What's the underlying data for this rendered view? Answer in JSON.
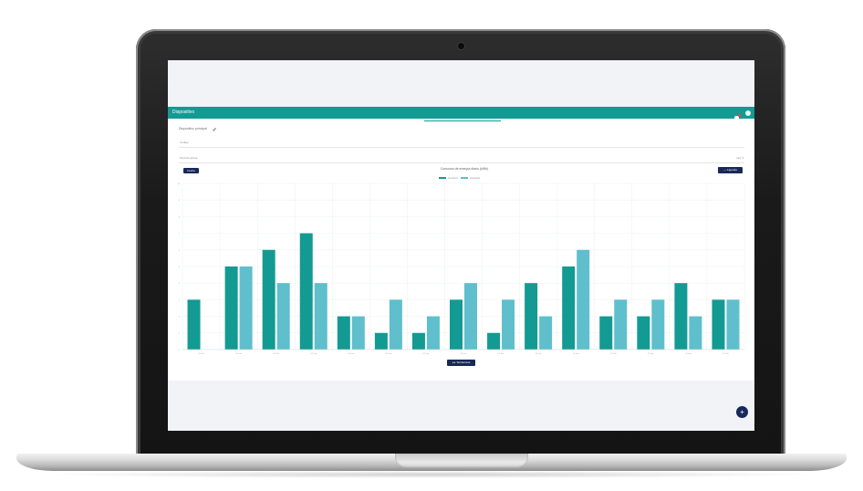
{
  "app": {
    "title": "Dispositivo",
    "page_title": "Dispositivo principal",
    "field_name_label": "Código",
    "field_period_label": "Período actual",
    "field_period_right": "Hoy ▾",
    "download_label": "Fecha",
    "legend_button_label": "— Ligenda",
    "nav_button_label": "◂ ▸ Tendencias",
    "fab_icon": "+"
  },
  "colors": {
    "primary": "#139a93",
    "secondary": "#5fbfcc",
    "navy": "#19285a",
    "alert": "#e4473d"
  },
  "chart_data": {
    "type": "bar",
    "title": "Consumo de energía diario (kWh)",
    "legend": [
      "Consumo",
      "Esperado"
    ],
    "categories": [
      "01 Feb",
      "02 Feb",
      "03 Feb",
      "04 Feb",
      "05 Feb",
      "06 Feb",
      "07 Feb",
      "08 Feb",
      "09 Feb",
      "10 Feb",
      "11 Feb",
      "12 Feb",
      "13 Feb",
      "14 Feb",
      "15 Feb"
    ],
    "series": [
      {
        "name": "Consumo",
        "values": [
          3,
          5,
          6,
          7,
          2,
          1,
          1,
          3,
          1,
          4,
          5,
          2,
          2,
          4,
          3
        ]
      },
      {
        "name": "Esperado",
        "values": [
          null,
          5,
          4,
          4,
          2,
          3,
          2,
          4,
          3,
          2,
          6,
          3,
          3,
          2,
          3
        ]
      }
    ],
    "ylim": [
      0,
      10
    ],
    "yticks": [
      "0",
      "1",
      "2",
      "3",
      "4",
      "5",
      "6",
      "7",
      "8",
      "9",
      "10"
    ],
    "grid": true,
    "legend_position": "top-center"
  }
}
